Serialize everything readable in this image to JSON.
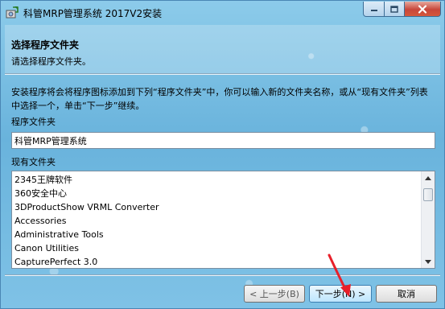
{
  "window": {
    "title": "科管MRP管理系统 2017V2安装"
  },
  "header": {
    "title": "选择程序文件夹",
    "subtitle": "请选择程序文件夹。"
  },
  "body": {
    "description": "安装程序将会将程序图标添加到下列“程序文件夹”中，你可以输入新的文件夹名称，或从“现有文件夹”列表中选择一个，单击“下一步”继续。",
    "program_folder_label": "程序文件夹",
    "program_folder_value": "科管MRP管理系统",
    "existing_folders_label": "现有文件夹",
    "existing_folders": [
      "2345王牌软件",
      "360安全中心",
      "3DProductShow VRML Converter",
      "Accessories",
      "Administrative Tools",
      "Canon Utilities",
      "CapturePerfect 3.0"
    ]
  },
  "buttons": {
    "back": "< 上一步(B)",
    "next": "下一步(N) >",
    "cancel": "取消"
  },
  "colors": {
    "annotation_arrow": "#e8202a",
    "window_border": "#4a86b4"
  },
  "icons": {
    "app": "setup-disk-icon",
    "minimize": "minimize-icon",
    "maximize": "maximize-icon",
    "close": "close-icon",
    "scroll_up": "scroll-up-icon",
    "scroll_down": "scroll-down-icon"
  }
}
